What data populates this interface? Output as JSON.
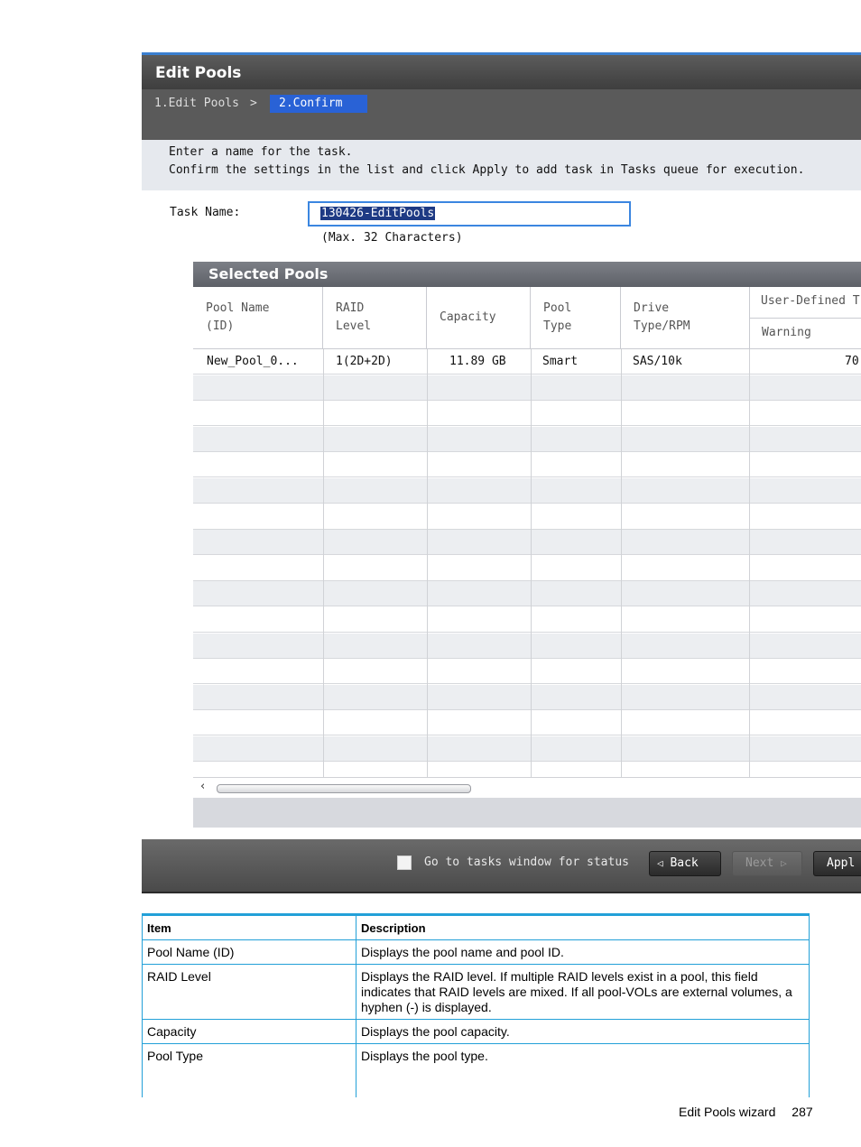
{
  "dialog": {
    "title": "Edit Pools",
    "steps": {
      "step1": "1.Edit Pools",
      "separator": ">",
      "step2": "2.Confirm"
    },
    "instructions": [
      "Enter a name for the task.",
      "Confirm the settings in the list and click Apply to add task in Tasks queue for execution."
    ],
    "task_name": {
      "label": "Task Name:",
      "value": "130426-EditPools",
      "hint": "(Max. 32 Characters)"
    }
  },
  "selected_pools": {
    "title": "Selected Pools",
    "columns": {
      "pool_name": [
        "Pool Name",
        "(ID)"
      ],
      "raid_level": [
        "RAID",
        "Level"
      ],
      "capacity": "Capacity",
      "pool_type": [
        "Pool",
        "Type"
      ],
      "drive": [
        "Drive",
        "Type/RPM"
      ],
      "user_defined": "User-Defined T",
      "warning": "Warning"
    },
    "rows": [
      {
        "pool_name": "New_Pool_0...",
        "raid_level": "1(2D+2D)",
        "capacity": "11.89 GB",
        "pool_type": "Smart",
        "drive": "SAS/10k",
        "warning": "70"
      }
    ]
  },
  "footer": {
    "goto_tasks_label": "Go to tasks window for status",
    "back_label": "Back",
    "next_label": "Next",
    "apply_label": "Appl"
  },
  "doc_table": {
    "headers": {
      "item": "Item",
      "description": "Description"
    },
    "rows": [
      {
        "item": "Pool Name (ID)",
        "description": "Displays the pool name and pool ID."
      },
      {
        "item": "RAID Level",
        "description": "Displays the RAID level. If multiple RAID levels exist in a pool, this field indicates that RAID levels are mixed. If all pool-VOLs are external volumes, a hyphen (-) is displayed."
      },
      {
        "item": "Capacity",
        "description": "Displays the pool capacity."
      },
      {
        "item": "Pool Type",
        "description": "Displays the pool type."
      }
    ]
  },
  "page_footer": {
    "section": "Edit Pools wizard",
    "page_number": "287"
  }
}
